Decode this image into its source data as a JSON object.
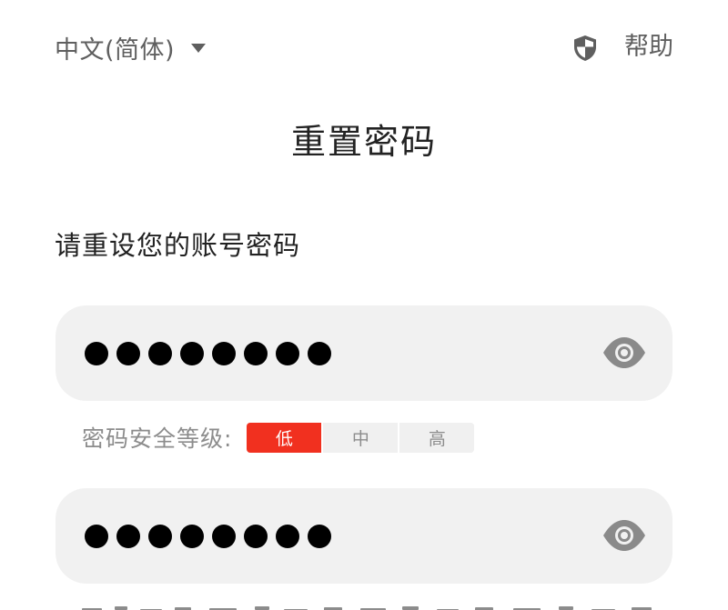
{
  "header": {
    "language_label": "中文(简体)",
    "help_label": "帮助"
  },
  "title": "重置密码",
  "subtitle": "请重设您的账号密码",
  "password_field": {
    "masked_length": 8
  },
  "confirm_field": {
    "masked_length": 8
  },
  "strength": {
    "label": "密码安全等级:",
    "levels": [
      "低",
      "中",
      "高"
    ],
    "active_level": "低"
  },
  "colors": {
    "accent": "#f1301f",
    "field_bg": "#f1f1f1",
    "muted_text": "#8c8c8c",
    "icon_gray": "#8a8a8a"
  },
  "icons": {
    "language_dropdown": "caret-down-icon",
    "security": "shield-icon",
    "visibility": "eye-icon"
  }
}
